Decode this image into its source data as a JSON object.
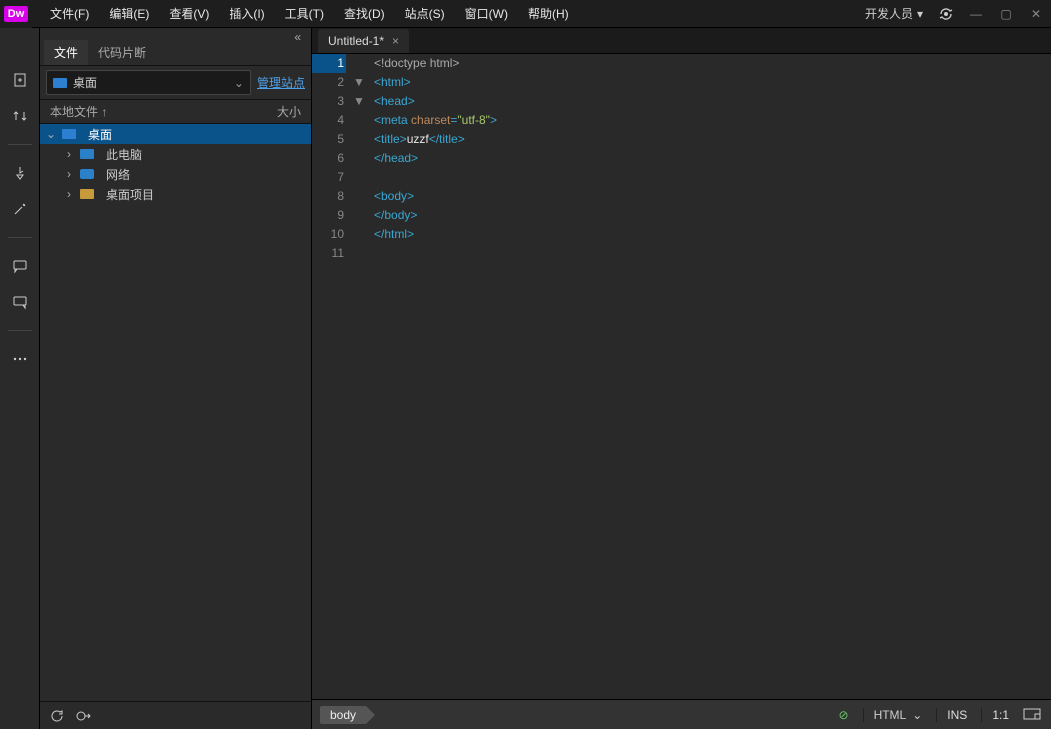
{
  "app": {
    "logo": "Dw"
  },
  "menu": [
    "文件(F)",
    "编辑(E)",
    "查看(V)",
    "插入(I)",
    "工具(T)",
    "查找(D)",
    "站点(S)",
    "窗口(W)",
    "帮助(H)"
  ],
  "workspace": {
    "role": "开发人员"
  },
  "panel": {
    "tabs": [
      "文件",
      "代码片断"
    ],
    "activeTab": 0,
    "site_select": "桌面",
    "manage_link": "管理站点",
    "list_header_left": "本地文件 ↑",
    "list_header_right": "大小",
    "tree": [
      {
        "label": "桌面",
        "depth": 0,
        "open": true,
        "icon": "folder-blue",
        "selected": true
      },
      {
        "label": "此电脑",
        "depth": 1,
        "open": false,
        "icon": "pc",
        "hasChildren": true
      },
      {
        "label": "网络",
        "depth": 1,
        "open": false,
        "icon": "net",
        "hasChildren": true
      },
      {
        "label": "桌面项目",
        "depth": 1,
        "open": false,
        "icon": "folder",
        "hasChildren": true
      }
    ]
  },
  "editor": {
    "tab": {
      "name": "Untitled-1*",
      "dirty": true
    },
    "current_line": 1,
    "lines": [
      {
        "n": 1,
        "fold": "",
        "tokens": [
          [
            "gray",
            "<!"
          ],
          [
            "gray",
            "doctype html"
          ],
          [
            "gray",
            ">"
          ]
        ]
      },
      {
        "n": 2,
        "fold": "▼",
        "tokens": [
          [
            "blue",
            "<html>"
          ]
        ]
      },
      {
        "n": 3,
        "fold": "▼",
        "tokens": [
          [
            "blue",
            "<head>"
          ]
        ]
      },
      {
        "n": 4,
        "fold": "",
        "tokens": [
          [
            "blue",
            "<meta "
          ],
          [
            "brown",
            "charset"
          ],
          [
            "blue",
            "="
          ],
          [
            "str",
            "\"utf-8\""
          ],
          [
            "blue",
            ">"
          ]
        ]
      },
      {
        "n": 5,
        "fold": "",
        "tokens": [
          [
            "blue",
            "<title>"
          ],
          [
            "white",
            "uzzf"
          ],
          [
            "blue",
            "</title>"
          ]
        ]
      },
      {
        "n": 6,
        "fold": "",
        "tokens": [
          [
            "blue",
            "</head>"
          ]
        ]
      },
      {
        "n": 7,
        "fold": "",
        "tokens": []
      },
      {
        "n": 8,
        "fold": "",
        "tokens": [
          [
            "blue",
            "<body>"
          ]
        ]
      },
      {
        "n": 9,
        "fold": "",
        "tokens": [
          [
            "blue",
            "</body>"
          ]
        ]
      },
      {
        "n": 10,
        "fold": "",
        "tokens": [
          [
            "blue",
            "</html>"
          ]
        ]
      },
      {
        "n": 11,
        "fold": "",
        "tokens": []
      }
    ]
  },
  "status": {
    "crumb": "body",
    "lang": "HTML",
    "insert": "INS",
    "lncol": "1:1"
  }
}
